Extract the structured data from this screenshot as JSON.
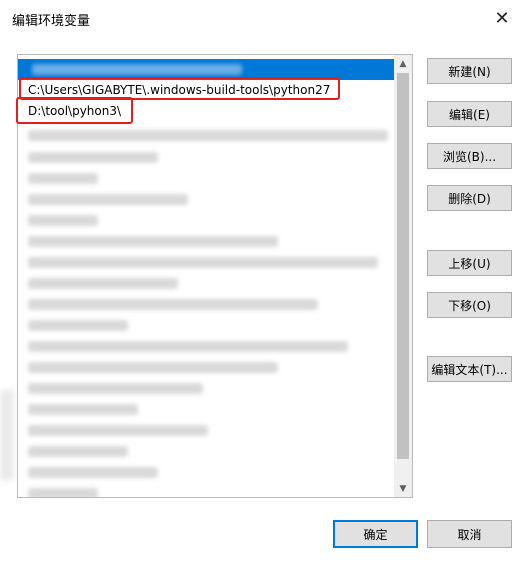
{
  "dialog": {
    "title": "编辑环境变量",
    "close_glyph": "✕"
  },
  "list": {
    "entries": [
      "",
      "C:\\Users\\GIGABYTE\\.windows-build-tools\\python27",
      "D:\\tool\\pyhon3\\"
    ],
    "scroll_up_glyph": "▲",
    "scroll_down_glyph": "▼"
  },
  "buttons": {
    "new": "新建(N)",
    "edit": "编辑(E)",
    "browse": "浏览(B)...",
    "delete": "删除(D)",
    "move_up": "上移(U)",
    "move_down": "下移(O)",
    "edit_text": "编辑文本(T)...",
    "ok": "确定",
    "cancel": "取消"
  },
  "colors": {
    "selection": "#0078d7",
    "highlight_marker": "#e02020"
  }
}
